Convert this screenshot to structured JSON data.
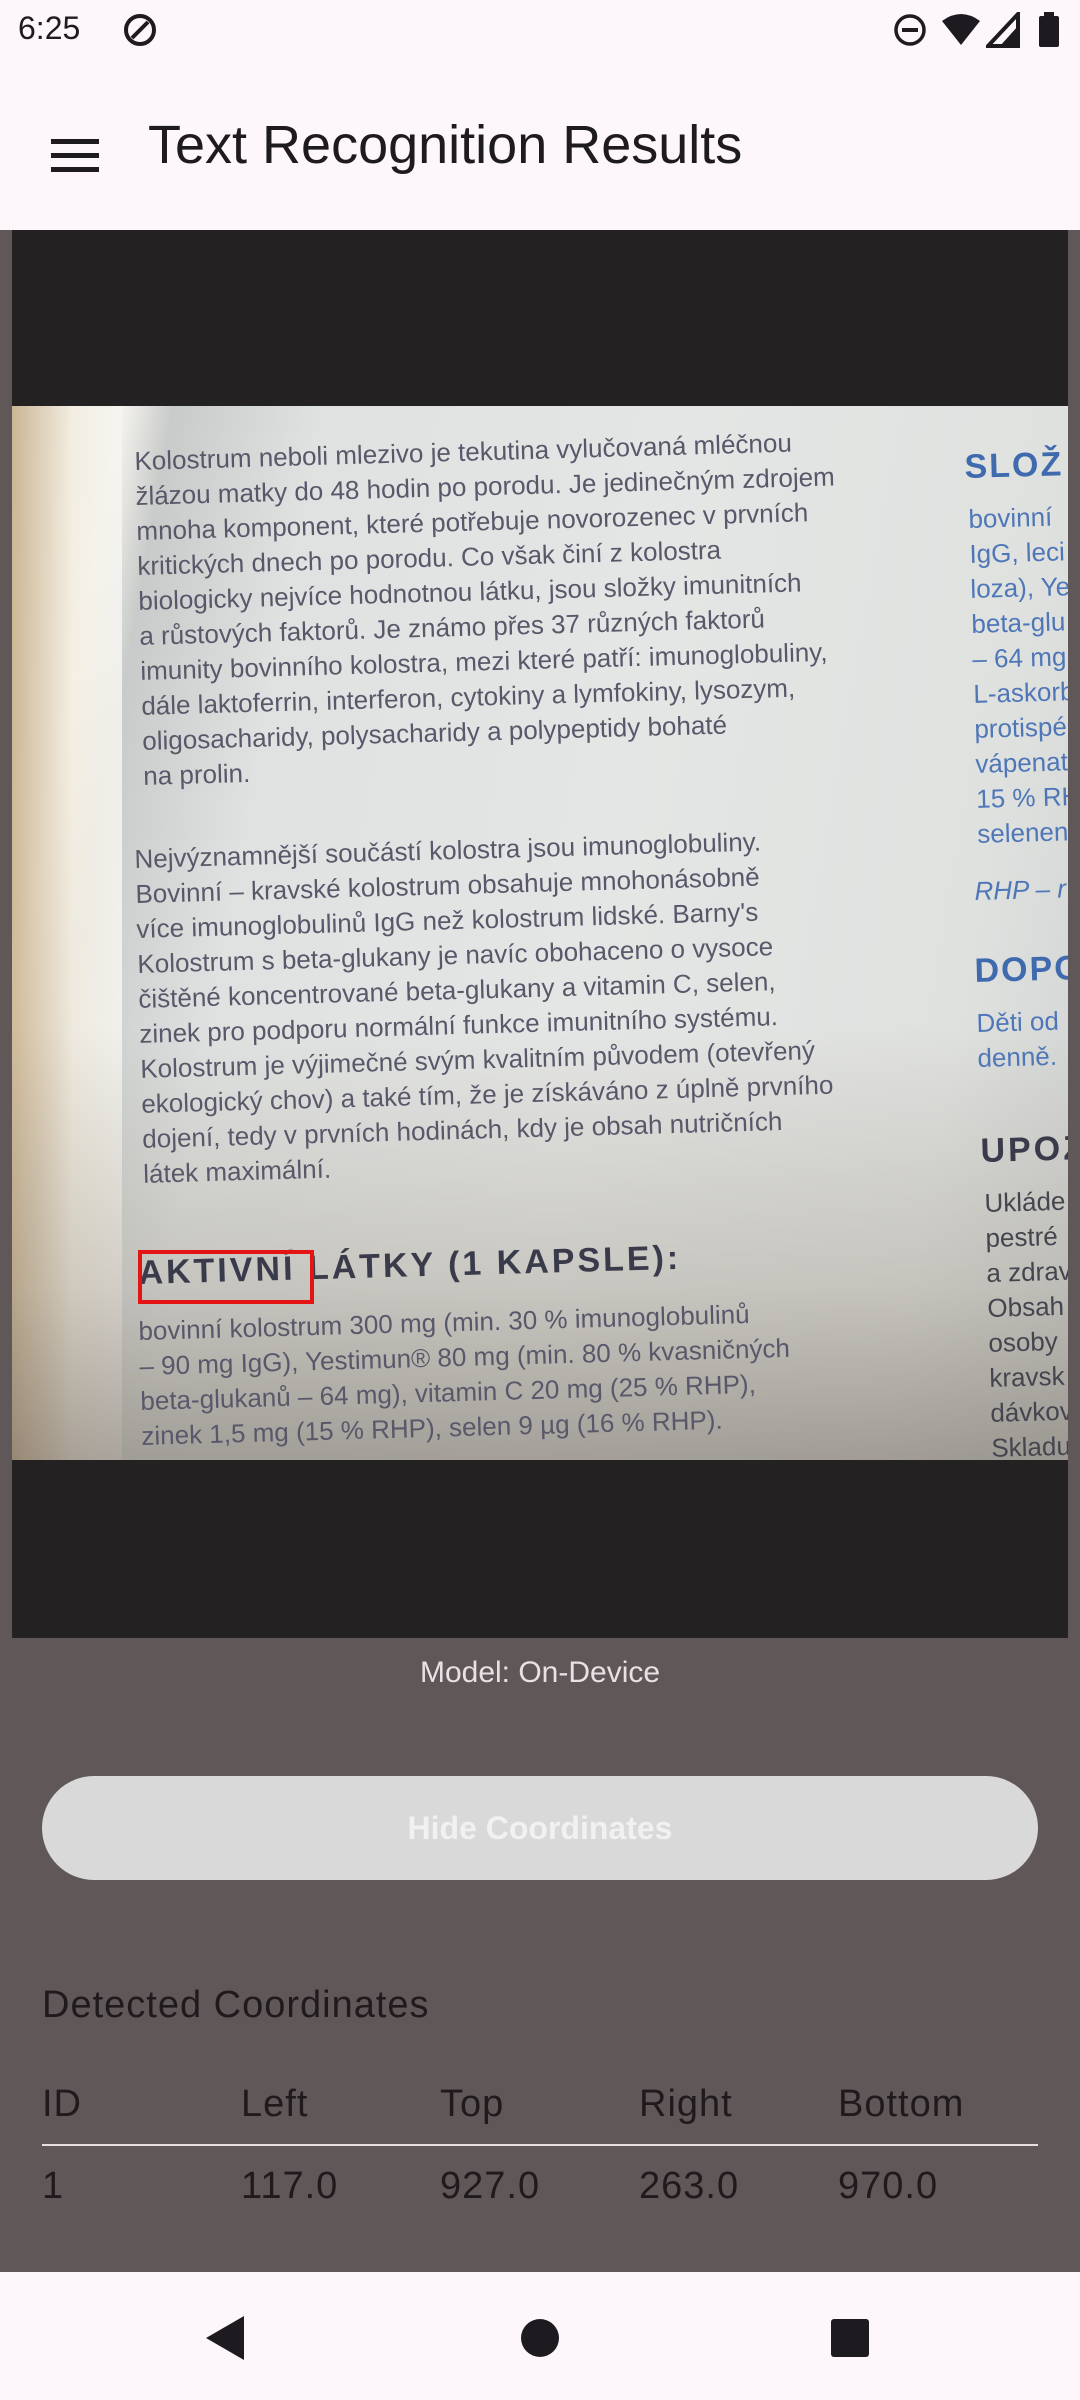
{
  "status_bar": {
    "time": "6:25",
    "icons": [
      "at-sign-icon",
      "do-not-disturb-icon",
      "wifi-icon",
      "signal-icon",
      "battery-icon"
    ]
  },
  "app_bar": {
    "menu_icon": "hamburger-menu-icon",
    "title": "Text Recognition Results"
  },
  "photo": {
    "paragraph1": "Kolostrum neboli mlezivo je tekutina vylučovaná mléčnou\nžlázou matky do 48 hodin po porodu. Je jedinečným zdrojem\nmnoha komponent, které potřebuje novorozenec v prvních\nkritických dnech po porodu. Co však činí z kolostra\nbiologicky nejvíce hodnotnou látku, jsou složky imunitních\na růstových faktorů. Je známo přes 37 různých faktorů\nimunity bovinního kolostra, mezi které patří: imunoglobuliny,\ndále laktoferrin, interferon, cytokiny a lymfokiny, lysozym,\noligosacharidy, polysacharidy a polypeptidy bohaté\nna prolin.",
    "paragraph2": "Nejvýznamnější součástí kolostra jsou imunoglobuliny.\nBovinní – kravské kolostrum obsahuje mnohonásobně\nvíce imunoglobulinů IgG než kolostrum lidské. Barny's\nKolostrum s beta-glukany je navíc obohaceno o vysoce\nčištěné koncentrované beta-glukany a vitamin C, selen,\nzinek pro podporu normální funkce imunitního systému.\nKolostrum je výjimečné svým kvalitním původem (otevřený\nekologický chov) a také tím, že je získáváno z úplně prvního\ndojení, tedy v prvních hodinách, kdy je obsah nutričních\nlátek maximální.",
    "active_heading_detected": "AKTIVNÍ",
    "active_heading_rest": "LÁTKY (1 KAPSLE):",
    "paragraph3": "bovinní kolostrum 300 mg (min. 30 % imunoglobulinů\n– 90 mg IgG), Yestimun® 80 mg (min. 80 % kvasničných\nbeta-glukanů – 64 mg), vitamin C 20 mg (25 % RHP),\nzinek 1,5 mg (15 % RHP), selen 9 µg (16 % RHP).",
    "right_heading1": "SLOŽ",
    "right_col1": "bovinní\nIgG, leci\nloza), Ye\nbeta-glu\n– 64 mg\nL-askorb\nprotispé\nvápenat\n15 % RH\nselenen",
    "right_note": "RHP – r",
    "right_heading2": "DOPO",
    "right_col2": "Děti od\ndenně.",
    "right_heading3": "UPOZ",
    "right_col3": "Ukláde\npestré\na zdrav\nObsah\nosoby\nkravsk\ndávkov\nSkladu"
  },
  "model_label": "Model: On-Device",
  "toggle_button_label": "Hide Coordinates",
  "coordinates": {
    "title": "Detected Coordinates",
    "headers": [
      "ID",
      "Left",
      "Top",
      "Right",
      "Bottom"
    ],
    "rows": [
      [
        "1",
        "117.0",
        "927.0",
        "263.0",
        "970.0"
      ]
    ]
  },
  "nav_bar": {
    "icons": [
      "back-icon",
      "home-icon",
      "recents-icon"
    ]
  },
  "colors": {
    "detection_box": "#e51414",
    "background": "#605759",
    "app_bar": "#fdf7fb"
  }
}
